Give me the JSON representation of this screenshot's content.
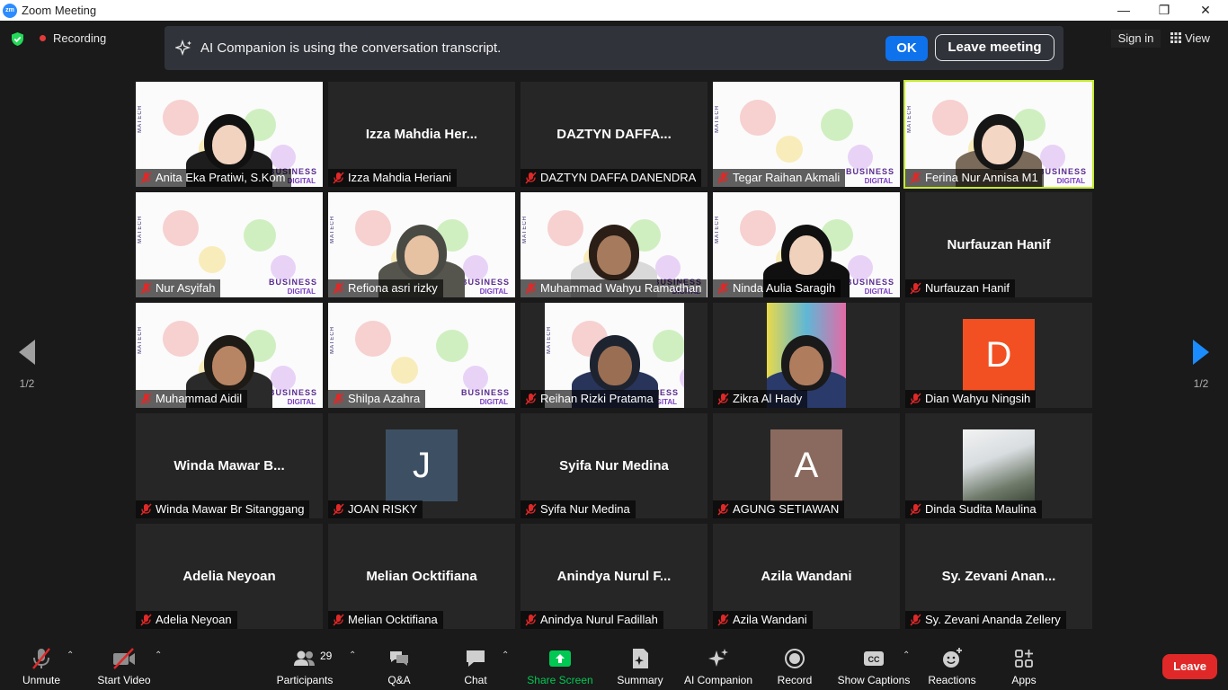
{
  "window": {
    "title": "Zoom Meeting",
    "minimize": "—",
    "maximize": "❐",
    "close": "✕"
  },
  "topbar": {
    "recording_label": "Recording",
    "notice_text": "AI Companion is using the conversation transcript.",
    "ok_label": "OK",
    "leave_meeting_label": "Leave meeting",
    "sign_in_label": "Sign in",
    "view_label": "View"
  },
  "pagination": {
    "left": "1/2",
    "right": "1/2"
  },
  "participants": [
    {
      "name": "Anita Eka Pratiwi, S.Kom",
      "display": "",
      "type": "video"
    },
    {
      "name": "Izza Mahdia Heriani",
      "display": "Izza Mahdia Her...",
      "type": "name"
    },
    {
      "name": "DAZTYN DAFFA DANENDRA",
      "display": "DAZTYN DAFFA...",
      "type": "name"
    },
    {
      "name": "Tegar Raihan Akmali",
      "display": "",
      "type": "video"
    },
    {
      "name": "Ferina Nur Annisa M1",
      "display": "",
      "type": "video",
      "speaking": true
    },
    {
      "name": "Nur Asyifah",
      "display": "",
      "type": "video"
    },
    {
      "name": "Refiona asri rizky",
      "display": "",
      "type": "video"
    },
    {
      "name": "Muhammad Wahyu Ramadhan",
      "display": "",
      "type": "video"
    },
    {
      "name": "Ninda Aulia Saragih",
      "display": "",
      "type": "video"
    },
    {
      "name": "Nurfauzan Hanif",
      "display": "Nurfauzan Hanif",
      "type": "name"
    },
    {
      "name": "Muhammad Aidil",
      "display": "",
      "type": "video"
    },
    {
      "name": "Shilpa Azahra",
      "display": "",
      "type": "video"
    },
    {
      "name": "Reihan Rizki Pratama",
      "display": "",
      "type": "video"
    },
    {
      "name": "Zikra Al Hady",
      "display": "",
      "type": "video"
    },
    {
      "name": "Dian Wahyu Ningsih",
      "display": "D",
      "type": "avatar"
    },
    {
      "name": "Winda Mawar Br Sitanggang",
      "display": "Winda Mawar B...",
      "type": "name"
    },
    {
      "name": "JOAN RISKY",
      "display": "J",
      "type": "avatar"
    },
    {
      "name": "Syifa Nur Medina",
      "display": "Syifa Nur Medina",
      "type": "name"
    },
    {
      "name": "AGUNG SETIAWAN",
      "display": "A",
      "type": "avatar"
    },
    {
      "name": "Dinda Sudita Maulina",
      "display": "",
      "type": "photo"
    },
    {
      "name": "Adelia Neyoan",
      "display": "Adelia Neyoan",
      "type": "name"
    },
    {
      "name": "Melian Ocktifiana",
      "display": "Melian Ocktifiana",
      "type": "name"
    },
    {
      "name": "Anindya Nurul Fadillah",
      "display": "Anindya Nurul F...",
      "type": "name"
    },
    {
      "name": "Azila Wandani",
      "display": "Azila Wandani",
      "type": "name"
    },
    {
      "name": "Sy. Zevani Ananda Zellery",
      "display": "Sy. Zevani Anan...",
      "type": "name"
    }
  ],
  "video_overlay": {
    "brand": "BUSINESS",
    "brand2": "DIGITAL",
    "tag": "MATECH"
  },
  "colors": {
    "speaker_border": "#c4ea30",
    "avatar_d": "#f25022",
    "avatar_j": "#3d4f63",
    "avatar_a": "#8a6a5f",
    "accent": "#0e72ed",
    "leave": "#e02828",
    "share": "#00c853"
  },
  "toolbar": {
    "unmute": "Unmute",
    "start_video": "Start Video",
    "participants": "Participants",
    "participant_count": "29",
    "qa": "Q&A",
    "chat": "Chat",
    "share_screen": "Share Screen",
    "summary": "Summary",
    "ai_companion": "AI Companion",
    "record": "Record",
    "show_captions": "Show Captions",
    "reactions": "Reactions",
    "apps": "Apps",
    "leave": "Leave"
  }
}
